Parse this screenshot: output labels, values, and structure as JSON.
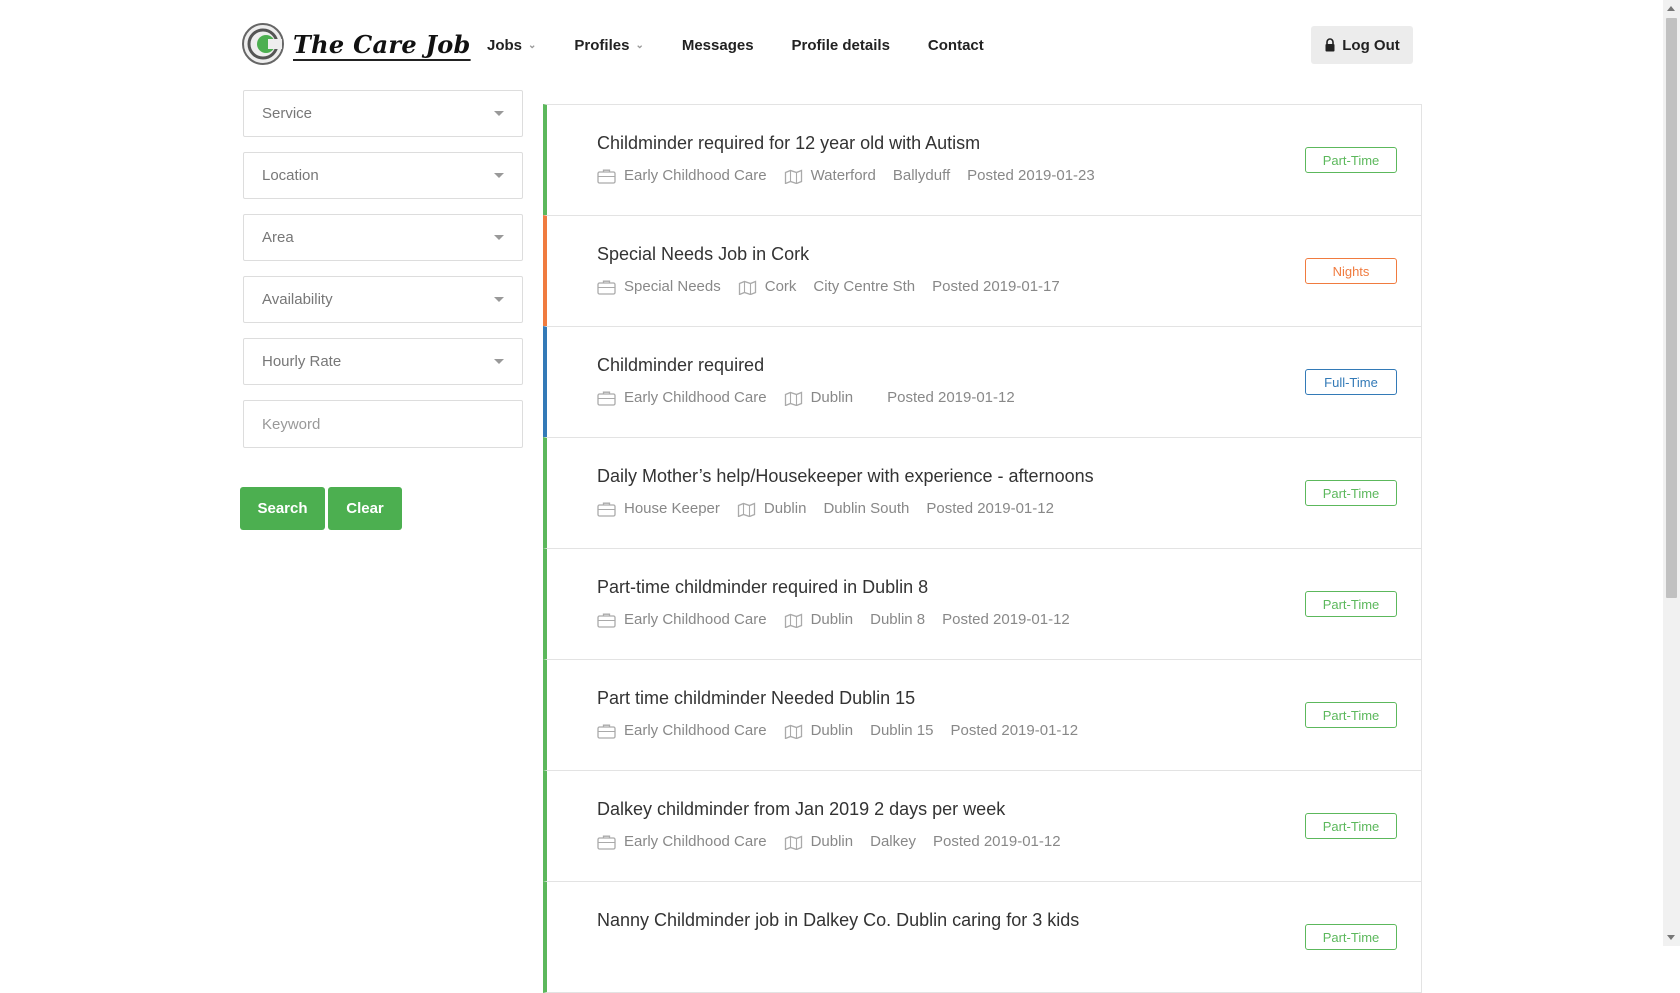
{
  "brand": {
    "name": "The Care Job",
    "logo_icon": "care-job-logo-icon"
  },
  "nav": [
    {
      "label": "Jobs",
      "dropdown": true
    },
    {
      "label": "Profiles",
      "dropdown": true
    },
    {
      "label": "Messages",
      "dropdown": false
    },
    {
      "label": "Profile details",
      "dropdown": false
    },
    {
      "label": "Contact",
      "dropdown": false
    }
  ],
  "logout_label": "Log Out",
  "filters": {
    "service": "Service",
    "location": "Location",
    "area": "Area",
    "availability": "Availability",
    "hourly_rate": "Hourly Rate",
    "keyword_placeholder": "Keyword"
  },
  "buttons": {
    "search": "Search",
    "clear": "Clear"
  },
  "colors": {
    "part_time": "#5cb85c",
    "nights": "#f07b3f",
    "full_time": "#337ab7",
    "accent_green": "#4caf50"
  },
  "jobs": [
    {
      "title": "Childminder required for 12 year old with Autism",
      "service": "Early Childhood Care",
      "location": "Waterford",
      "area": "Ballyduff",
      "posted": "Posted 2019-01-23",
      "badge": "Part-Time",
      "badge_type": "part_time"
    },
    {
      "title": "Special Needs Job in Cork",
      "service": "Special Needs",
      "location": "Cork",
      "area": "City Centre Sth",
      "posted": "Posted 2019-01-17",
      "badge": "Nights",
      "badge_type": "nights"
    },
    {
      "title": "Childminder required",
      "service": "Early Childhood Care",
      "location": "Dublin",
      "area": "",
      "posted": "Posted 2019-01-12",
      "badge": "Full-Time",
      "badge_type": "full_time"
    },
    {
      "title": "Daily Mother’s help/Housekeeper with experience - afternoons",
      "service": "House Keeper",
      "location": "Dublin",
      "area": "Dublin South",
      "posted": "Posted 2019-01-12",
      "badge": "Part-Time",
      "badge_type": "part_time"
    },
    {
      "title": "Part-time childminder required in Dublin 8",
      "service": "Early Childhood Care",
      "location": "Dublin",
      "area": "Dublin 8",
      "posted": "Posted 2019-01-12",
      "badge": "Part-Time",
      "badge_type": "part_time"
    },
    {
      "title": "Part time childminder Needed Dublin 15",
      "service": "Early Childhood Care",
      "location": "Dublin",
      "area": "Dublin 15",
      "posted": "Posted 2019-01-12",
      "badge": "Part-Time",
      "badge_type": "part_time"
    },
    {
      "title": "Dalkey childminder from Jan 2019 2 days per week",
      "service": "Early Childhood Care",
      "location": "Dublin",
      "area": "Dalkey",
      "posted": "Posted 2019-01-12",
      "badge": "Part-Time",
      "badge_type": "part_time"
    },
    {
      "title": "Nanny Childminder job in Dalkey Co. Dublin caring for 3 kids",
      "service": "",
      "location": "",
      "area": "",
      "posted": "",
      "badge": "Part-Time",
      "badge_type": "part_time"
    }
  ]
}
